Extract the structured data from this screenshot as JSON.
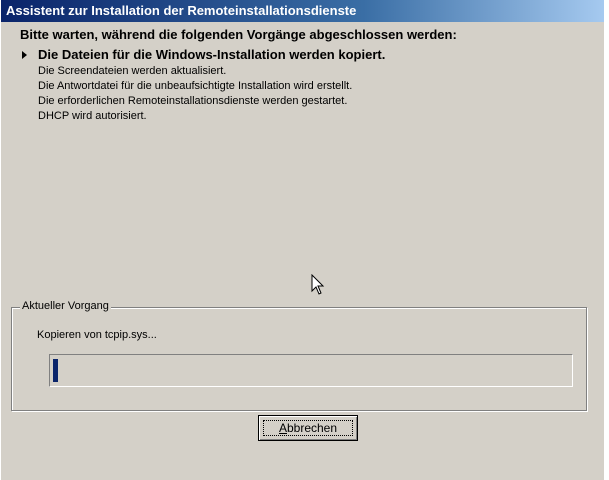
{
  "window": {
    "title": "Assistent zur Installation der Remoteinstallationsdienste"
  },
  "heading": "Bitte warten, während die folgenden Vorgänge abgeschlossen werden:",
  "tasks": [
    {
      "label": "Die Dateien für die Windows-Installation werden kopiert.",
      "active": true
    },
    {
      "label": "Die Screendateien werden aktualisiert.",
      "active": false
    },
    {
      "label": "Die Antwortdatei für die unbeaufsichtigte Installation wird erstellt.",
      "active": false
    },
    {
      "label": "Die erforderlichen Remoteinstallationsdienste werden gestartet.",
      "active": false
    },
    {
      "label": "DHCP wird autorisiert.",
      "active": false
    }
  ],
  "current_operation": {
    "group_label": "Aktueller Vorgang",
    "status_text": "Kopieren von tcpip.sys...",
    "progress_fraction": 0.01
  },
  "buttons": {
    "cancel_label_accel": "A",
    "cancel_label_rest": "bbrechen"
  },
  "icons": {
    "active_task": "arrow-right-icon",
    "pointer": "mouse-cursor-icon"
  },
  "colors": {
    "title_bar": "#0a246a",
    "dialog_face": "#d4d0c8",
    "progress_fill": "#0a246a"
  }
}
